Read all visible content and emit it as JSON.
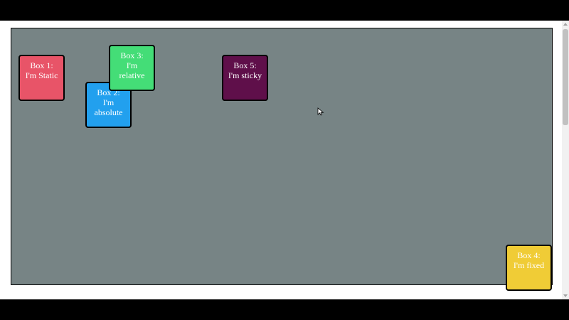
{
  "boxes": {
    "box1": {
      "title": "Box 1:",
      "caption": "I'm Static",
      "color": "#e85468"
    },
    "box2": {
      "title": "Box 2:",
      "caption_line1": "I'm",
      "caption_line2": "absolute",
      "color": "#22a0ee"
    },
    "box3": {
      "title": "Box 3:",
      "caption_line1": "I'm",
      "caption_line2": "relative",
      "color": "#44dd77"
    },
    "box4": {
      "title": "Box 4:",
      "caption": "I'm fixed",
      "color": "#f0cc36"
    },
    "box5": {
      "title": "Box 5:",
      "caption": "I'm sticky",
      "color": "#5f0f4a"
    }
  },
  "colors": {
    "container_background": "#778485",
    "page_background": "#ffffff",
    "outer_frame": "#000000"
  },
  "icons": {
    "cursor": "mouse-pointer-icon",
    "scroll_up": "scroll-up-arrow-icon",
    "scroll_down": "scroll-down-arrow-icon"
  }
}
